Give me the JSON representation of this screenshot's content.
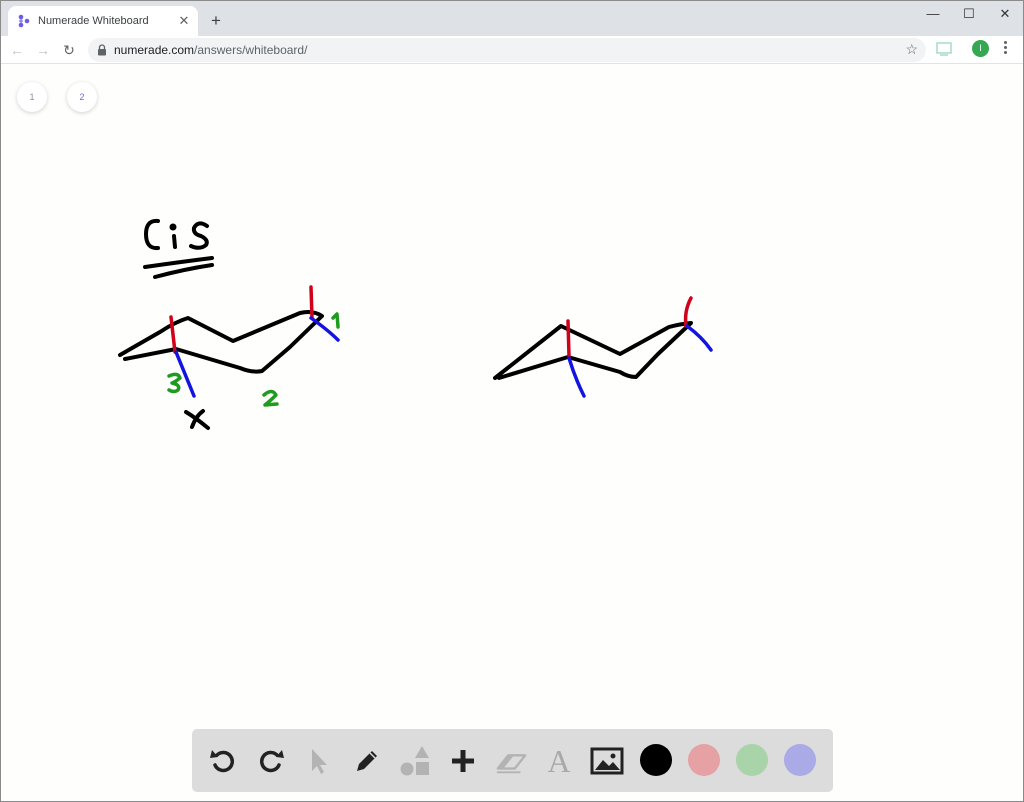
{
  "browser": {
    "tab_title": "Numerade Whiteboard",
    "tab_close": "✕",
    "new_tab": "+",
    "url_host": "numerade.com",
    "url_path": "/answers/whiteboard/",
    "avatar_letter": "I",
    "window_controls": {
      "minimize": "—",
      "maximize": "☐",
      "close": "✕"
    }
  },
  "whiteboard": {
    "pages": [
      {
        "label": "1"
      },
      {
        "label": "2"
      }
    ],
    "handwriting": {
      "title": "Cis",
      "carbon_labels": [
        "1",
        "2",
        "3"
      ],
      "mark": "X"
    },
    "colors": {
      "ink_black": "#000000",
      "ink_red": "#d0021b",
      "ink_blue": "#1414e0",
      "ink_green": "#1f9c1f"
    }
  },
  "palette": {
    "tools": [
      "undo-icon",
      "redo-icon",
      "select-icon",
      "pen-icon",
      "shapes-icon",
      "add-icon",
      "eraser-icon",
      "text-icon",
      "image-icon"
    ],
    "text_tool_glyph": "A",
    "swatches": [
      "#000000",
      "#e6a1a5",
      "#a9d3a9",
      "#aaaae6"
    ],
    "active_swatch": "#000000"
  }
}
